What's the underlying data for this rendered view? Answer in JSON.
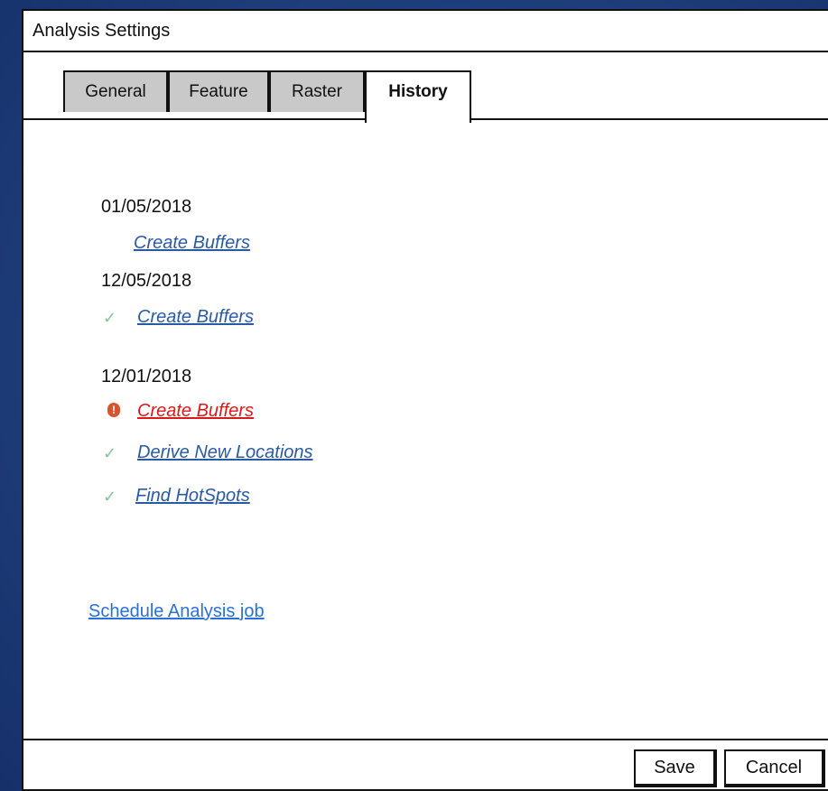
{
  "window": {
    "title": "Analysis Settings"
  },
  "tabs": [
    {
      "label": "General",
      "active": false
    },
    {
      "label": "Feature",
      "active": false
    },
    {
      "label": "Raster",
      "active": false
    },
    {
      "label": "History",
      "active": true
    }
  ],
  "history": [
    {
      "date": "01/05/2018",
      "items": [
        {
          "label": "Create Buffers",
          "status": "none"
        }
      ]
    },
    {
      "date": "12/05/2018",
      "items": [
        {
          "label": "Create Buffers",
          "status": "success"
        }
      ]
    },
    {
      "date": "12/01/2018",
      "items": [
        {
          "label": "Create Buffers",
          "status": "error"
        },
        {
          "label": "Derive New Locations",
          "status": "success"
        },
        {
          "label": "Find HotSpots",
          "status": "success"
        }
      ]
    }
  ],
  "schedule_link": "Schedule Analysis job",
  "buttons": {
    "save": "Save",
    "cancel": "Cancel"
  },
  "icons": {
    "success": "check-icon",
    "error": "error-icon"
  },
  "colors": {
    "link": "#2a5aa4",
    "error": "#d81a1a",
    "check": "#8cc29a",
    "schedule": "#2a70d8"
  }
}
